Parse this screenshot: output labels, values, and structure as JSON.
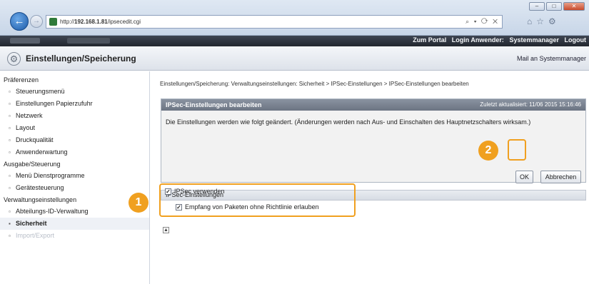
{
  "browser": {
    "url_prefix": "http://",
    "url_host": "192.168.1.81",
    "url_path": "/ipsecedit.cgi",
    "window_buttons": [
      "minimize",
      "maximize",
      "close"
    ],
    "address_icons": "⌕ ▾ ⟳ ✕",
    "toolbar_icons": [
      "home-icon",
      "star-icon",
      "gear-icon"
    ]
  },
  "header": {
    "portal_link": "Zum Portal",
    "login_label": "Login Anwender:",
    "login_user": "Systemmanager",
    "logout": "Logout"
  },
  "titlebar": {
    "title": "Einstellungen/Speicherung",
    "mail_link": "Mail an Systemmanager"
  },
  "sidebar": {
    "sections": [
      {
        "label": "Präferenzen",
        "items": [
          "Steuerungsmenü",
          "Einstellungen Papierzufuhr",
          "Netzwerk",
          "Layout",
          "Druckqualität",
          "Anwenderwartung"
        ]
      },
      {
        "label": "Ausgabe/Steuerung",
        "items": [
          "Menü Dienstprogramme",
          "Gerätesteuerung"
        ]
      },
      {
        "label": "Verwaltungseinstellungen",
        "items": [
          "Abteilungs-ID-Verwaltung",
          "Sicherheit",
          "Import/Export"
        ]
      }
    ]
  },
  "content": {
    "breadcrumb": "Einstellungen/Speicherung: Verwaltungseinstellungen: Sicherheit > IPSec-Einstellungen > IPSec-Einstellungen bearbeiten",
    "panel": {
      "title": "IPSec-Einstellungen bearbeiten",
      "updated": "Zuletzt aktualisiert: 11/06 2015 15:16:46",
      "message": "Die Einstellungen werden wie folgt geändert. (Änderungen werden nach Aus- und Einschalten des Hauptnetzschalters wirksam.)",
      "ok_label": "OK",
      "cancel_label": "Abbrechen"
    },
    "section_title": "IPSec-Einstellungen",
    "checkbox_use_ipsec": {
      "label": "IPSec verwenden",
      "checked": true
    },
    "checkbox_allow_no_policy": {
      "label": "Empfang von Paketen ohne Richtlinie erlauben",
      "checked": true
    },
    "scroll_top_icon": "▲"
  },
  "callouts": [
    "1",
    "2"
  ],
  "colors": {
    "callout": "#f0a020",
    "dark_header": "#2a2f38",
    "panel_header": "#7a8391"
  }
}
